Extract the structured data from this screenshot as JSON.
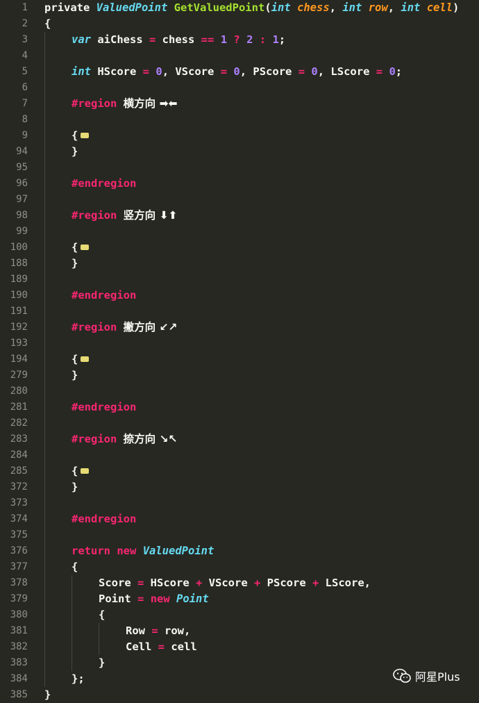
{
  "editor": {
    "lines": [
      {
        "num": "1",
        "indent": 0,
        "tokens": [
          {
            "t": "kw-plain",
            "v": "private "
          },
          {
            "t": "tname",
            "v": "ValuedPoint"
          },
          {
            "t": "plain",
            "v": " "
          },
          {
            "t": "fn",
            "v": "GetValuedPoint"
          },
          {
            "t": "plain",
            "v": "("
          },
          {
            "t": "type",
            "v": "int"
          },
          {
            "t": "plain",
            "v": " "
          },
          {
            "t": "param",
            "v": "chess"
          },
          {
            "t": "plain",
            "v": ", "
          },
          {
            "t": "type",
            "v": "int"
          },
          {
            "t": "plain",
            "v": " "
          },
          {
            "t": "param",
            "v": "row"
          },
          {
            "t": "plain",
            "v": ", "
          },
          {
            "t": "type",
            "v": "int"
          },
          {
            "t": "plain",
            "v": " "
          },
          {
            "t": "param",
            "v": "cell"
          },
          {
            "t": "plain",
            "v": ")"
          }
        ]
      },
      {
        "num": "2",
        "indent": 0,
        "tokens": [
          {
            "t": "plain",
            "v": "{"
          }
        ]
      },
      {
        "num": "3",
        "indent": 1,
        "tokens": [
          {
            "t": "type",
            "v": "var"
          },
          {
            "t": "plain",
            "v": " aiChess "
          },
          {
            "t": "op",
            "v": "="
          },
          {
            "t": "plain",
            "v": " chess "
          },
          {
            "t": "op",
            "v": "=="
          },
          {
            "t": "plain",
            "v": " "
          },
          {
            "t": "num",
            "v": "1"
          },
          {
            "t": "plain",
            "v": " "
          },
          {
            "t": "op",
            "v": "?"
          },
          {
            "t": "plain",
            "v": " "
          },
          {
            "t": "num",
            "v": "2"
          },
          {
            "t": "plain",
            "v": " "
          },
          {
            "t": "op",
            "v": ":"
          },
          {
            "t": "plain",
            "v": " "
          },
          {
            "t": "num",
            "v": "1"
          },
          {
            "t": "plain",
            "v": ";"
          }
        ]
      },
      {
        "num": "4",
        "indent": 1,
        "tokens": []
      },
      {
        "num": "5",
        "indent": 1,
        "tokens": [
          {
            "t": "type",
            "v": "int"
          },
          {
            "t": "plain",
            "v": " HScore "
          },
          {
            "t": "op",
            "v": "="
          },
          {
            "t": "plain",
            "v": " "
          },
          {
            "t": "num",
            "v": "0"
          },
          {
            "t": "plain",
            "v": ", VScore "
          },
          {
            "t": "op",
            "v": "="
          },
          {
            "t": "plain",
            "v": " "
          },
          {
            "t": "num",
            "v": "0"
          },
          {
            "t": "plain",
            "v": ", PScore "
          },
          {
            "t": "op",
            "v": "="
          },
          {
            "t": "plain",
            "v": " "
          },
          {
            "t": "num",
            "v": "0"
          },
          {
            "t": "plain",
            "v": ", LScore "
          },
          {
            "t": "op",
            "v": "="
          },
          {
            "t": "plain",
            "v": " "
          },
          {
            "t": "num",
            "v": "0"
          },
          {
            "t": "plain",
            "v": ";"
          }
        ]
      },
      {
        "num": "6",
        "indent": 1,
        "tokens": []
      },
      {
        "num": "7",
        "indent": 1,
        "tokens": [
          {
            "t": "region",
            "v": "#region"
          },
          {
            "t": "plain",
            "v": " "
          },
          {
            "t": "label",
            "v": "横方向 ➡⬅"
          }
        ]
      },
      {
        "num": "8",
        "indent": 1,
        "tokens": []
      },
      {
        "num": "9",
        "indent": 1,
        "fold": true,
        "tokens": [
          {
            "t": "plain",
            "v": "{"
          }
        ]
      },
      {
        "num": "94",
        "indent": 1,
        "tokens": [
          {
            "t": "plain",
            "v": "}"
          }
        ]
      },
      {
        "num": "95",
        "indent": 1,
        "tokens": []
      },
      {
        "num": "96",
        "indent": 1,
        "tokens": [
          {
            "t": "region",
            "v": "#endregion"
          }
        ]
      },
      {
        "num": "97",
        "indent": 1,
        "tokens": []
      },
      {
        "num": "98",
        "indent": 1,
        "tokens": [
          {
            "t": "region",
            "v": "#region"
          },
          {
            "t": "plain",
            "v": " "
          },
          {
            "t": "label",
            "v": "竖方向 ⬇⬆"
          }
        ]
      },
      {
        "num": "99",
        "indent": 1,
        "tokens": []
      },
      {
        "num": "100",
        "indent": 1,
        "fold": true,
        "tokens": [
          {
            "t": "plain",
            "v": "{"
          }
        ]
      },
      {
        "num": "188",
        "indent": 1,
        "tokens": [
          {
            "t": "plain",
            "v": "}"
          }
        ]
      },
      {
        "num": "189",
        "indent": 1,
        "tokens": []
      },
      {
        "num": "190",
        "indent": 1,
        "tokens": [
          {
            "t": "region",
            "v": "#endregion"
          }
        ]
      },
      {
        "num": "191",
        "indent": 1,
        "tokens": []
      },
      {
        "num": "192",
        "indent": 1,
        "tokens": [
          {
            "t": "region",
            "v": "#region"
          },
          {
            "t": "plain",
            "v": " "
          },
          {
            "t": "label",
            "v": "撇方向 ↙↗"
          }
        ]
      },
      {
        "num": "193",
        "indent": 1,
        "tokens": []
      },
      {
        "num": "194",
        "indent": 1,
        "fold": true,
        "tokens": [
          {
            "t": "plain",
            "v": "{"
          }
        ]
      },
      {
        "num": "279",
        "indent": 1,
        "tokens": [
          {
            "t": "plain",
            "v": "}"
          }
        ]
      },
      {
        "num": "280",
        "indent": 1,
        "tokens": []
      },
      {
        "num": "281",
        "indent": 1,
        "tokens": [
          {
            "t": "region",
            "v": "#endregion"
          }
        ]
      },
      {
        "num": "282",
        "indent": 1,
        "tokens": []
      },
      {
        "num": "283",
        "indent": 1,
        "tokens": [
          {
            "t": "region",
            "v": "#region"
          },
          {
            "t": "plain",
            "v": " "
          },
          {
            "t": "label",
            "v": "捺方向 ↘↖"
          }
        ]
      },
      {
        "num": "284",
        "indent": 1,
        "tokens": []
      },
      {
        "num": "285",
        "indent": 1,
        "fold": true,
        "tokens": [
          {
            "t": "plain",
            "v": "{"
          }
        ]
      },
      {
        "num": "372",
        "indent": 1,
        "tokens": [
          {
            "t": "plain",
            "v": "}"
          }
        ]
      },
      {
        "num": "373",
        "indent": 1,
        "tokens": []
      },
      {
        "num": "374",
        "indent": 1,
        "tokens": [
          {
            "t": "region",
            "v": "#endregion"
          }
        ]
      },
      {
        "num": "375",
        "indent": 1,
        "tokens": []
      },
      {
        "num": "376",
        "indent": 1,
        "tokens": [
          {
            "t": "kw",
            "v": "return"
          },
          {
            "t": "plain",
            "v": " "
          },
          {
            "t": "kw",
            "v": "new"
          },
          {
            "t": "plain",
            "v": " "
          },
          {
            "t": "tname",
            "v": "ValuedPoint"
          }
        ]
      },
      {
        "num": "377",
        "indent": 1,
        "tokens": [
          {
            "t": "plain",
            "v": "{"
          }
        ]
      },
      {
        "num": "378",
        "indent": 2,
        "tokens": [
          {
            "t": "plain",
            "v": "Score "
          },
          {
            "t": "op",
            "v": "="
          },
          {
            "t": "plain",
            "v": " HScore "
          },
          {
            "t": "op",
            "v": "+"
          },
          {
            "t": "plain",
            "v": " VScore "
          },
          {
            "t": "op",
            "v": "+"
          },
          {
            "t": "plain",
            "v": " PScore "
          },
          {
            "t": "op",
            "v": "+"
          },
          {
            "t": "plain",
            "v": " LScore,"
          }
        ]
      },
      {
        "num": "379",
        "indent": 2,
        "tokens": [
          {
            "t": "plain",
            "v": "Point "
          },
          {
            "t": "op",
            "v": "="
          },
          {
            "t": "plain",
            "v": " "
          },
          {
            "t": "kw",
            "v": "new"
          },
          {
            "t": "plain",
            "v": " "
          },
          {
            "t": "tname",
            "v": "Point"
          }
        ]
      },
      {
        "num": "380",
        "indent": 2,
        "tokens": [
          {
            "t": "plain",
            "v": "{"
          }
        ]
      },
      {
        "num": "381",
        "indent": 3,
        "tokens": [
          {
            "t": "plain",
            "v": "Row "
          },
          {
            "t": "op",
            "v": "="
          },
          {
            "t": "plain",
            "v": " row,"
          }
        ]
      },
      {
        "num": "382",
        "indent": 3,
        "tokens": [
          {
            "t": "plain",
            "v": "Cell "
          },
          {
            "t": "op",
            "v": "="
          },
          {
            "t": "plain",
            "v": " cell"
          }
        ]
      },
      {
        "num": "383",
        "indent": 2,
        "tokens": [
          {
            "t": "plain",
            "v": "}"
          }
        ]
      },
      {
        "num": "384",
        "indent": 1,
        "tokens": [
          {
            "t": "plain",
            "v": "};"
          }
        ]
      },
      {
        "num": "385",
        "indent": 0,
        "tokens": [
          {
            "t": "plain",
            "v": "}"
          }
        ]
      }
    ]
  },
  "watermark": {
    "text": "阿星Plus",
    "icon": "wechat-icon"
  },
  "colors": {
    "background": "#272822",
    "keyword": "#f92672",
    "type": "#66d9ef",
    "function": "#a6e22e",
    "parameter": "#fd971f",
    "number": "#ae81ff",
    "line_number": "#8f908a",
    "fold_marker": "#e6db74"
  }
}
